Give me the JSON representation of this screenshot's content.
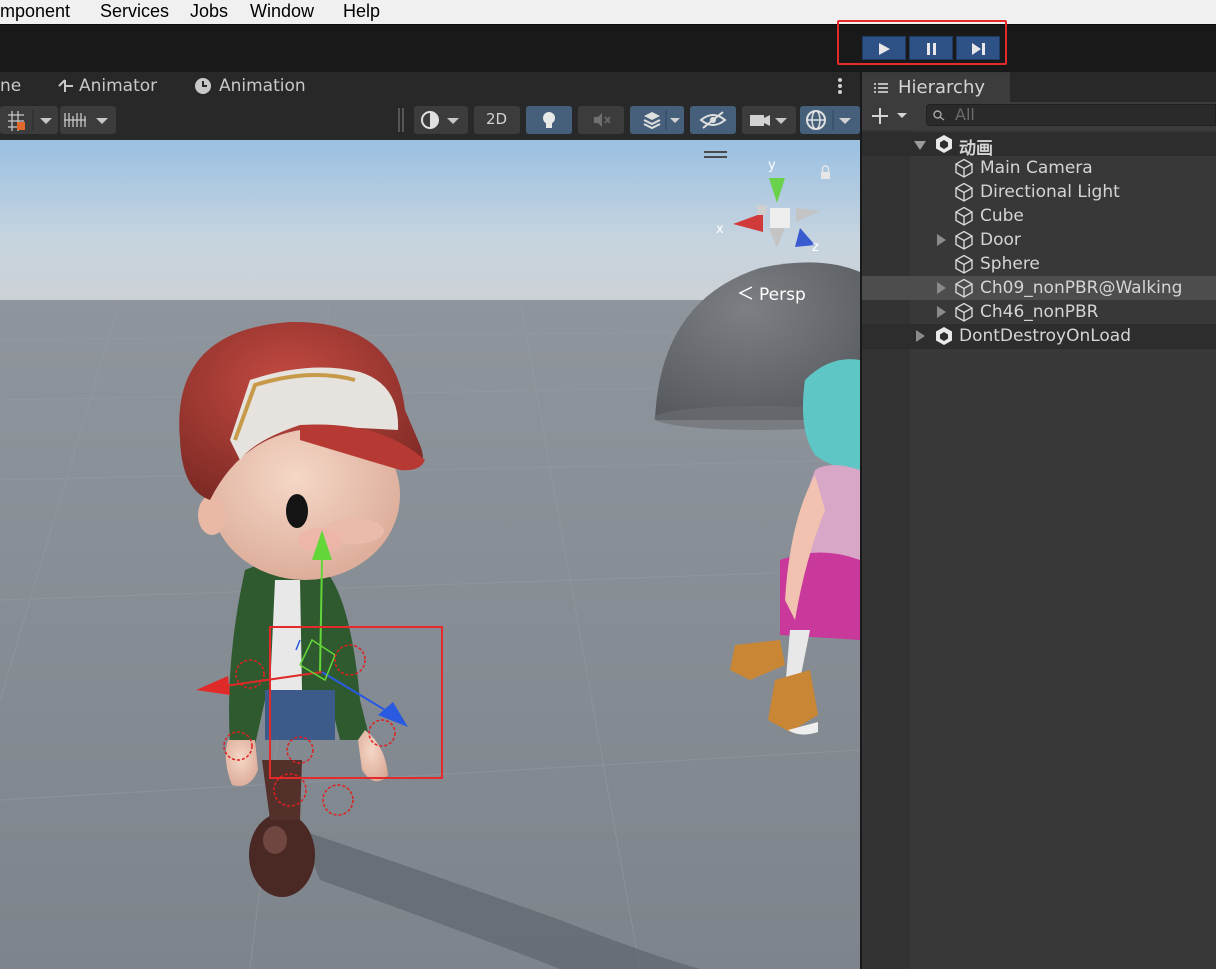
{
  "menu": {
    "items": [
      "mponent",
      "Services",
      "Jobs",
      "Window",
      "Help"
    ]
  },
  "play_controls": {
    "play": "play",
    "pause": "pause",
    "step": "step"
  },
  "scene_tabs": {
    "scene_fragment": "ne",
    "animator": "Animator",
    "animation": "Animation"
  },
  "scene_toolbar": {
    "btn_2d": "2D"
  },
  "scene_view": {
    "projection": "Persp",
    "gizmo_x": "x",
    "gizmo_y": "y",
    "gizmo_z": "z"
  },
  "hierarchy": {
    "tab_label": "Hierarchy",
    "search_placeholder": "All",
    "scene_name": "动画",
    "items": [
      {
        "label": "Main Camera",
        "expandable": false
      },
      {
        "label": "Directional Light",
        "expandable": false
      },
      {
        "label": "Cube",
        "expandable": false
      },
      {
        "label": "Door",
        "expandable": true
      },
      {
        "label": "Sphere",
        "expandable": false
      },
      {
        "label": "Ch09_nonPBR@Walking",
        "expandable": true,
        "selected": true
      },
      {
        "label": "Ch46_nonPBR",
        "expandable": true
      }
    ],
    "dont_destroy": "DontDestroyOnLoad"
  },
  "colors": {
    "accent": "#2f5286",
    "highlight": "#e42a2a",
    "panel": "#383838"
  }
}
